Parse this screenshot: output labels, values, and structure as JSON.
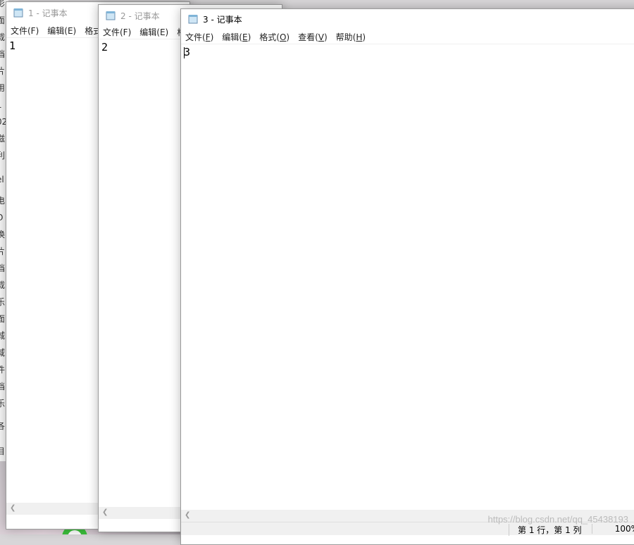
{
  "windows": [
    {
      "title": "1 - 记事本",
      "menu": [
        "文件(F)",
        "编辑(E)",
        "格式"
      ],
      "content": "1"
    },
    {
      "title": "2 - 记事本",
      "menu": [
        "文件(F)",
        "编辑(E)",
        "格"
      ],
      "content": "2"
    },
    {
      "title": "3 - 记事本",
      "menu": [
        {
          "text": "文件(",
          "key": "F",
          "end": ")"
        },
        {
          "text": "编辑(",
          "key": "E",
          "end": ")"
        },
        {
          "text": "格式(",
          "key": "O",
          "end": ")"
        },
        {
          "text": "查看(",
          "key": "V",
          "end": ")"
        },
        {
          "text": "帮助(",
          "key": "H",
          "end": ")"
        }
      ],
      "content": "3",
      "status": {
        "position": "第 1 行，第 1 列",
        "zoom": "100%"
      }
    }
  ],
  "desktop_fragments": [
    "影",
    "面",
    "载",
    "档",
    "片",
    "用",
    "1",
    "02",
    "滋",
    "利",
    "el",
    "电",
    "O",
    "换",
    "片",
    "档",
    "载",
    "乐",
    "面",
    "城",
    "域",
    "件",
    "档",
    "乐",
    "各",
    "目"
  ],
  "watermark": "https://blog.csdn.net/qq_45438193",
  "icons": {
    "notepad": "notepad-icon"
  }
}
